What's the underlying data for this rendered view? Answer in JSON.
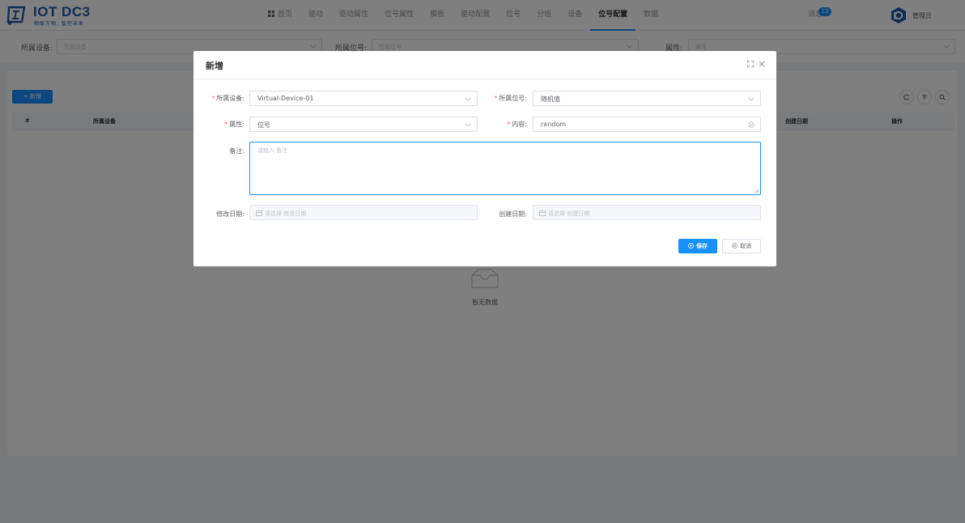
{
  "app": {
    "logo_text": "IOT DC3",
    "logo_slogan": "物联万物, 智控未来",
    "brand_color": "#1e5aa8",
    "accent_color": "#1890ff"
  },
  "nav": {
    "items": [
      {
        "label": "首页",
        "icon": "grid-icon"
      },
      {
        "label": "驱动"
      },
      {
        "label": "驱动属性"
      },
      {
        "label": "位号属性"
      },
      {
        "label": "模板"
      },
      {
        "label": "驱动配置"
      },
      {
        "label": "位号"
      },
      {
        "label": "分组"
      },
      {
        "label": "设备"
      },
      {
        "label": "位号配置",
        "active": true
      },
      {
        "label": "数据"
      }
    ]
  },
  "header": {
    "message_label": "消息",
    "message_count": "12",
    "user_name": "管理员"
  },
  "search": {
    "device_label": "所属设备:",
    "device_placeholder": "所属设备",
    "point_label": "所属位号:",
    "point_placeholder": "所属位号",
    "attribute_label": "属性:",
    "attribute_placeholder": "属性"
  },
  "toolbar": {
    "add_label": "+ 新增"
  },
  "table": {
    "columns": [
      "#",
      "所属设备",
      "创建日期",
      "操作"
    ],
    "empty_text": "暂无数据"
  },
  "dialog": {
    "title": "新增",
    "device_label": "所属设备:",
    "device_value": "Virtual-Device-01",
    "point_label": "所属位号:",
    "point_value": "随机值",
    "attribute_label": "属性:",
    "attribute_value": "位号",
    "content_label": "内容:",
    "content_value": "random",
    "remark_label": "备注:",
    "remark_placeholder": "请输入 备注",
    "update_date_label": "修改日期:",
    "update_date_placeholder": "请选择 修改日期",
    "create_date_label": "创建日期:",
    "create_date_placeholder": "请选择 创建日期",
    "save_label": "保存",
    "cancel_label": "取消",
    "required_mark": "*"
  }
}
